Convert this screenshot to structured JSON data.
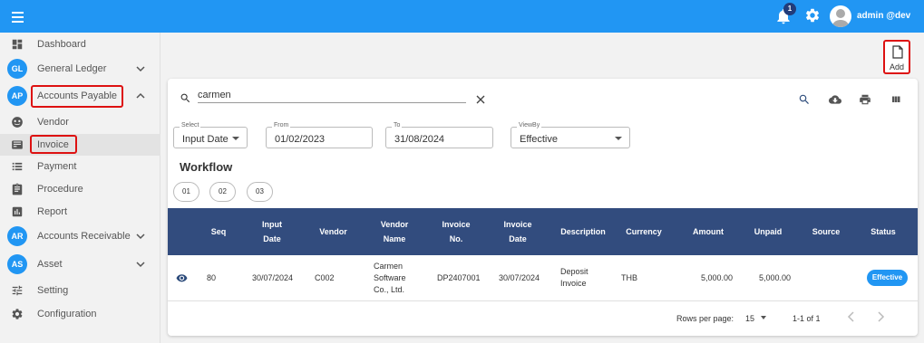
{
  "topbar": {
    "notification_count": "1",
    "user_name": "admin @dev",
    "icons": [
      "menu-icon",
      "bell-icon",
      "gear-icon",
      "user-avatar-icon"
    ]
  },
  "sidebar": {
    "items": [
      {
        "label": "Dashboard",
        "icon": "dashboard-icon"
      },
      {
        "label": "General Ledger",
        "badge": "GL"
      },
      {
        "label": "Accounts Payable",
        "badge": "AP"
      },
      {
        "label": "Vendor",
        "icon": "vendor-icon"
      },
      {
        "label": "Invoice",
        "icon": "invoice-icon"
      },
      {
        "label": "Payment",
        "icon": "payment-icon"
      },
      {
        "label": "Procedure",
        "icon": "procedure-icon"
      },
      {
        "label": "Report",
        "icon": "report-icon"
      },
      {
        "label": "Accounts Receivable",
        "badge": "AR"
      },
      {
        "label": "Asset",
        "badge": "AS"
      },
      {
        "label": "Setting",
        "icon": "setting-icon"
      },
      {
        "label": "Configuration",
        "icon": "configuration-icon"
      }
    ]
  },
  "add_button": {
    "label": "Add"
  },
  "search": {
    "value": "carmen"
  },
  "filters": {
    "select": {
      "label": "Select",
      "value": "Input Date"
    },
    "from": {
      "label": "From",
      "value": "01/02/2023"
    },
    "to": {
      "label": "To",
      "value": "31/08/2024"
    },
    "viewby": {
      "label": "ViewBy",
      "value": "Effective"
    }
  },
  "workflow": {
    "title": "Workflow",
    "steps": [
      "01",
      "02",
      "03"
    ]
  },
  "table": {
    "headers": {
      "seq": "Seq",
      "input_date_1": "Input",
      "input_date_2": "Date",
      "vendor": "Vendor",
      "vendor_name_1": "Vendor",
      "vendor_name_2": "Name",
      "invoice_no_1": "Invoice",
      "invoice_no_2": "No.",
      "invoice_date_1": "Invoice",
      "invoice_date_2": "Date",
      "description": "Description",
      "currency": "Currency",
      "amount": "Amount",
      "unpaid": "Unpaid",
      "source": "Source",
      "status": "Status"
    },
    "rows": [
      {
        "seq": "80",
        "input_date": "30/07/2024",
        "vendor": "C002",
        "vendor_name_1": "Carmen",
        "vendor_name_2": "Software",
        "vendor_name_3": "Co., Ltd.",
        "invoice_no": "DP2407001",
        "invoice_date": "30/07/2024",
        "description_1": "Deposit",
        "description_2": "Invoice",
        "currency": "THB",
        "amount": "5,000.00",
        "unpaid": "5,000.00",
        "source": "",
        "status": "Effective"
      }
    ]
  },
  "pagination": {
    "rows_per_page_label": "Rows per page:",
    "rows_per_page_value": "15",
    "range": "1-1 of 1"
  },
  "colors": {
    "primary": "#2196f3",
    "table_header": "#324c7e",
    "highlight_border": "#dd1111"
  }
}
